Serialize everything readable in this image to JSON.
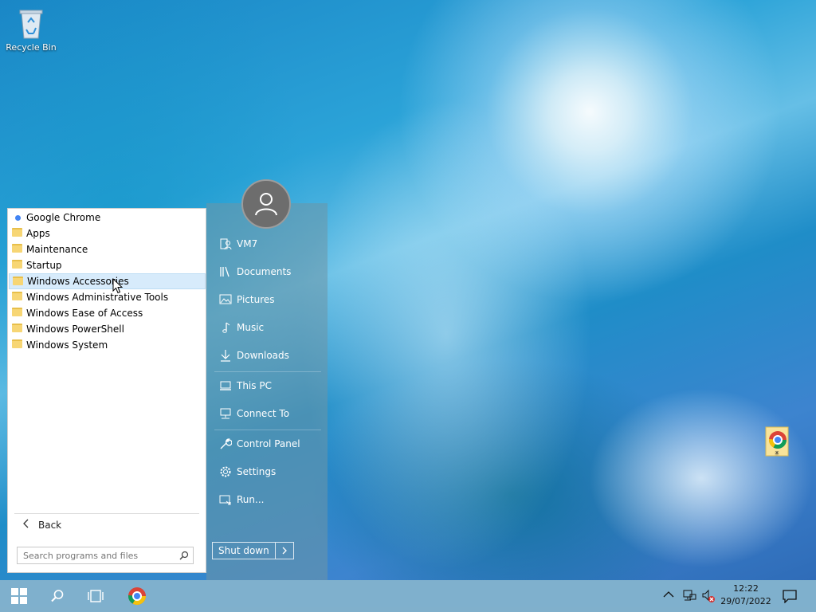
{
  "desktop": {
    "icons": [
      {
        "label": "Recycle Bin",
        "icon": "recycle-bin-icon"
      },
      {
        "label": "",
        "icon": "chrome-shortcut-icon"
      }
    ]
  },
  "start_menu": {
    "programs": [
      {
        "label": "Google Chrome",
        "icon": "chrome-icon"
      },
      {
        "label": "Apps",
        "icon": "folder-icon"
      },
      {
        "label": "Maintenance",
        "icon": "folder-icon"
      },
      {
        "label": "Startup",
        "icon": "folder-icon"
      },
      {
        "label": "Windows Accessories",
        "icon": "folder-icon",
        "selected": true
      },
      {
        "label": "Windows Administrative Tools",
        "icon": "folder-icon"
      },
      {
        "label": "Windows Ease of Access",
        "icon": "folder-icon"
      },
      {
        "label": "Windows PowerShell",
        "icon": "folder-icon"
      },
      {
        "label": "Windows System",
        "icon": "folder-icon"
      }
    ],
    "back_label": "Back",
    "search_placeholder": "Search programs and files",
    "places": [
      {
        "label": "VM7",
        "icon": "user-folder-icon"
      },
      {
        "label": "Documents",
        "icon": "documents-icon"
      },
      {
        "label": "Pictures",
        "icon": "pictures-icon"
      },
      {
        "label": "Music",
        "icon": "music-icon"
      },
      {
        "label": "Downloads",
        "icon": "downloads-icon"
      },
      {
        "label": "This PC",
        "icon": "computer-icon"
      },
      {
        "label": "Connect To",
        "icon": "network-icon"
      },
      {
        "label": "Control Panel",
        "icon": "wrench-icon"
      },
      {
        "label": "Settings",
        "icon": "gear-icon"
      },
      {
        "label": "Run...",
        "icon": "run-icon"
      }
    ],
    "shutdown_label": "Shut down"
  },
  "taskbar": {
    "buttons": [
      "windows-start-icon",
      "search-icon",
      "task-view-icon",
      "chrome-icon"
    ],
    "tray": {
      "time": "12:22",
      "date": "29/07/2022"
    }
  },
  "colors": {
    "selection": "#d7ebfb",
    "taskbar": "#87b4cd",
    "folder": "#f7d675"
  }
}
